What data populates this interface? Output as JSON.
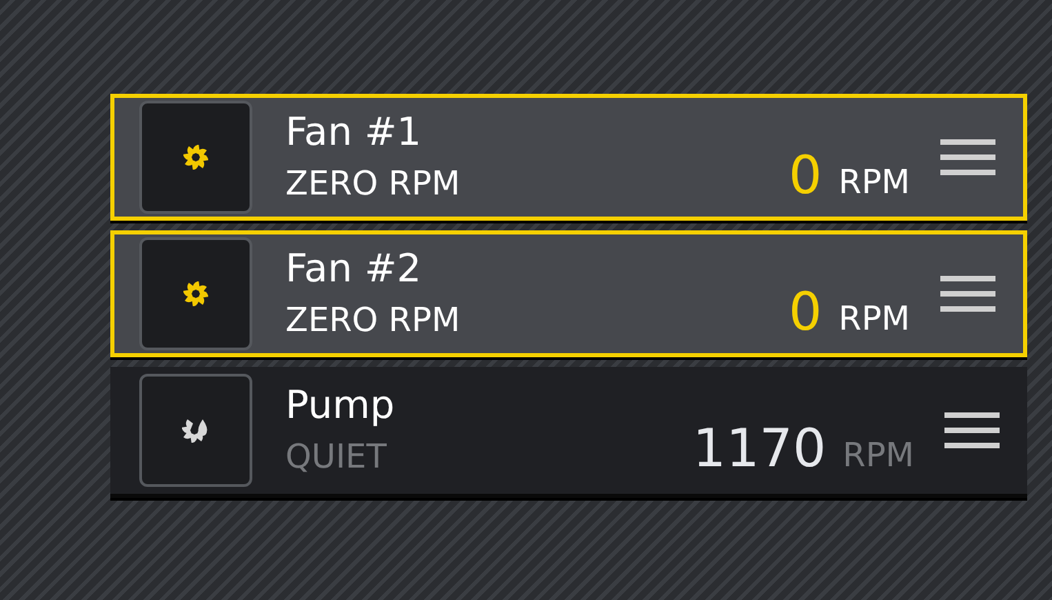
{
  "devices": [
    {
      "kind": "fan",
      "name": "Fan #1",
      "mode": "ZERO RPM",
      "speed": "0",
      "unit": "RPM",
      "selected": true
    },
    {
      "kind": "fan",
      "name": "Fan #2",
      "mode": "ZERO RPM",
      "speed": "0",
      "unit": "RPM",
      "selected": true
    },
    {
      "kind": "pump",
      "name": "Pump",
      "mode": "QUIET",
      "speed": "1170",
      "unit": "RPM",
      "selected": false
    }
  ]
}
